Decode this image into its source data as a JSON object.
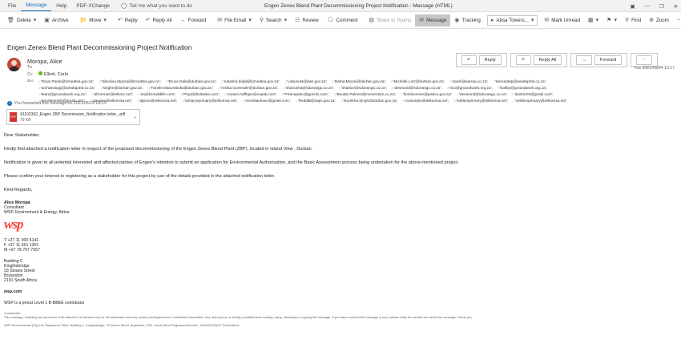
{
  "window": {
    "title": "Engen Zenex Blend Plant Decommissioning Project Notification  -  Message (HTML)",
    "menu": [
      "File",
      "Message",
      "Help",
      "PDF-XChange"
    ],
    "tell_me": "Tell me what you want to do"
  },
  "ribbon": {
    "delete": "Delete",
    "archive": "Archive",
    "move": "Move",
    "reply": "Reply",
    "reply_all": "Reply All",
    "forward": "Forward",
    "file_email": "File Email",
    "search": "Search",
    "review": "Review",
    "comment": "Comment",
    "share_teams": "Share to Teams",
    "message": "Message",
    "tracking": "Tracking",
    "absa": "Absa Towers...",
    "mark_unread": "Mark Unread",
    "find": "Find",
    "zoom": "Zoom"
  },
  "email": {
    "subject": "Engen Zenex Blend Plant Decommissioning Project Notification",
    "sender": "Moropa, Alice",
    "to_label": "To",
    "cc_label": "Cc",
    "cc_value": "Elliott, Carla",
    "bcc_label": "Bcc",
    "bcc": [
      "'Omar.Parak@kznedtea.gov.za';",
      "'Sibusiso.Myeza@kznedtea.gov.za';",
      "'Bruce.Dale@durban.gov.za';",
      "'natasha.brijlal@kznedtea.gov.za';",
      "'LebunuN@dws.gov.za';",
      "'Batha.Msomi@durban.gov.za';",
      "'Michelle.Lotz@durban.gov.za';",
      "'sarah@wessa.co.za';",
      "'bernadetp@amafapmb.co.za';",
      "'archaeology@amafapmb.co.za';",
      "'singhe@durban.gov.za';",
      "'Fanele.Masombuka@durban.gov.za';",
      "'Anitha.Govender@durban.gov.za';",
      "'shanusha@sdceango.co.za';",
      "'shanice@sdceango.co.za';",
      "'desmond@sdceango.co.za';",
      "'rico@groundwork.org.za';",
      "'bobby@groundwork.org.za';",
      "'team@groundwork.org.za';",
      "'afrormatz@telkom.net';",
      "'ea@kznwildlife.com';",
      "'Priya@bvltanks.com';",
      "'moiam.haffejee@vopak.com';",
      "'PSanupdeo@gozuts.com';",
      "'Beulah.Palmer@momentum.co.za';",
      "'llomihomme@justice.gov.za';",
      "'desmond@sdceango.co.za';",
      "'dusher03@gmail.com';",
      "'apostlesmith@gmail.com';",
      "'ganges@telkomsa.net';",
      "'alpore@telkomsa.net';",
      "'stmarysprimary@telkomsa.net';",
      "'merebanksec@gmail.com';",
      "'ReddiB@saps.gov.za';",
      "'Eurekha.Singh@durban.gov.za';",
      "'rustomjee@telkomsa.net';",
      "'settlersprimary@telkomsa.net';",
      "'settlersprimary@telkomsa.net'"
    ],
    "actions": {
      "reply": "Reply",
      "reply_all": "Reply All",
      "forward": "Forward"
    },
    "date": "Tue 2021/05/04 10:17",
    "forwarded_note": "You forwarded this message on 2021/06/15 10:23.",
    "attachment": {
      "name": "41102362_Engen ZBP Decomission_Notification letter_.pdf",
      "size": "79 KB",
      "type": "PDF"
    }
  },
  "body": {
    "greeting": "Dear Stakeholder,",
    "p1": "Kindly find attached a notification letter in respect of the proposed decommissioning of the Engen Zenex Blend Plant (ZBP), located in Island View , Durban.",
    "p2": "Notification is given to all potential interested and affected parties of Engen’s intention to submit an application for Environmental Authorisation, and the Basic Assessment process being undertaken for the above-mentioned project.",
    "p3": "Please confirm your interest in registering as a stakeholder for this project by use of the details provided in the attached notification letter.",
    "closing": "Kind Regards,"
  },
  "signature": {
    "name": "Alice Moropa",
    "title": "Consultant",
    "company": "WSP, Environment & Energy, Africa",
    "logo": "wsp",
    "phones": [
      "T +27 11 300 6141",
      "F +27 11 361 1301",
      "M +27 78 707 7057"
    ],
    "address": [
      "Building C",
      "Knightsbridge",
      "33 Sloane Street",
      "Bryanston",
      "2191 South Africa"
    ],
    "website": "wsp.com",
    "bbbee": "WSP is a proud Level 1 B-BBEE contributor",
    "confidential_label": "Confidential",
    "confidential_text": "This message, including any document or file attached, is intended only for the addressee and may contain privileged and/or confidential information. Any other person is strictly prohibited from reading, using, disclosing or copying this message. If you have received this message in error, please notify the sender and delete the message. Thank you.",
    "registration": "WSP Environmental (Pty) Ltd, Registered Office: Building C, Knightsbridge, 33 Sloane Street, Bryanston, 2191, South Africa Registered Number: 1995/007209/07 South Africa"
  }
}
